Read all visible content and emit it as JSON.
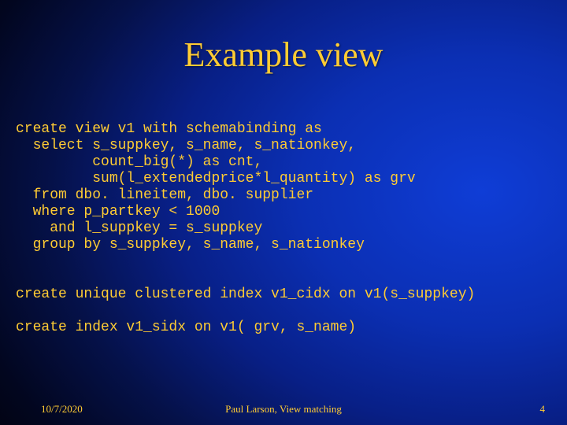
{
  "slide": {
    "title": "Example view",
    "body": "create view v1 with schemabinding as\n  select s_suppkey, s_name, s_nationkey,\n         count_big(*) as cnt,\n         sum(l_extendedprice*l_quantity) as grv\n  from dbo. lineitem, dbo. supplier\n  where p_partkey < 1000\n    and l_suppkey = s_suppkey\n  group by s_suppkey, s_name, s_nationkey\n\n\ncreate unique clustered index v1_cidx on v1(s_suppkey)\n\ncreate index v1_sidx on v1( grv, s_name)"
  },
  "footer": {
    "date": "10/7/2020",
    "author": "Paul Larson, View matching",
    "page": "4"
  }
}
